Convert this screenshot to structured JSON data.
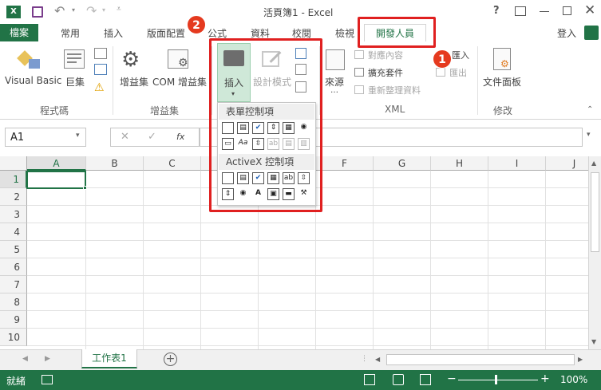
{
  "window": {
    "title": "活頁簿1 - Excel",
    "help": "?",
    "signin": "登入"
  },
  "tabs": [
    "檔案",
    "常用",
    "插入",
    "版面配置",
    "公式",
    "資料",
    "校閱",
    "檢視",
    "開發人員"
  ],
  "ribbon": {
    "code_group": {
      "label": "程式碼",
      "vb": "Visual Basic",
      "macros": "巨集"
    },
    "addins_group": {
      "label": "增益集",
      "addins": "增益集",
      "com": "COM 增益集"
    },
    "controls": {
      "insert": "插入",
      "design_mode": "設計模式"
    },
    "xml_group": {
      "label": "XML",
      "source": "來源",
      "map_props": "對應內容",
      "expansion": "擴充套件",
      "refresh": "重新整理資料",
      "import": "匯入",
      "export": "匯出"
    },
    "modify_group": {
      "label": "修改",
      "doc_panel": "文件面板"
    }
  },
  "popup": {
    "form_controls": "表單控制項",
    "activex_controls": "ActiveX 控制項"
  },
  "formula_bar": {
    "name_box": "A1",
    "fx": "fx"
  },
  "columns": [
    "A",
    "B",
    "C",
    "D",
    "E",
    "F",
    "G",
    "H",
    "I",
    "J"
  ],
  "rows": [
    "1",
    "2",
    "3",
    "4",
    "5",
    "6",
    "7",
    "8",
    "9",
    "10"
  ],
  "sheet_tab": "工作表1",
  "status": {
    "ready": "就緒",
    "zoom": "100%",
    "minus": "−",
    "plus": "+"
  },
  "callouts": [
    "1",
    "2"
  ],
  "colors": {
    "excel_green": "#217346",
    "accent_tab": "#217346",
    "callout_red": "#e02020",
    "badge": "#e53a1f"
  }
}
